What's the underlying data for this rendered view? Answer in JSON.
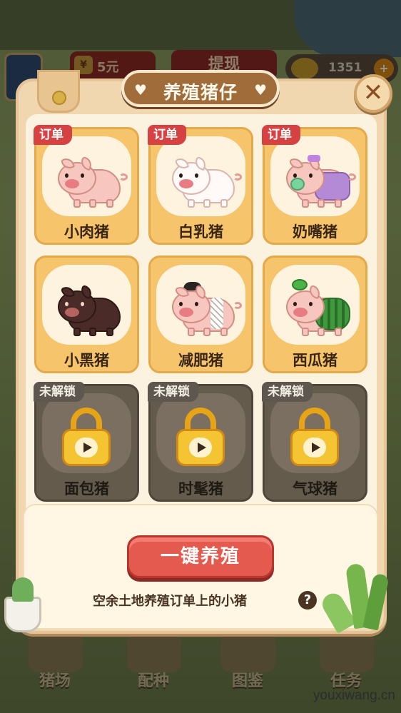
{
  "hud": {
    "cash_icon": "¥",
    "cash_value": "5元",
    "withdraw_label": "提现",
    "coins_value": "1351",
    "coins_add": "+"
  },
  "dialog": {
    "title": "养殖猪仔",
    "heart_glyph": "♥",
    "close_glyph": "✕",
    "cards": [
      {
        "name": "小肉猪",
        "tag": "订单",
        "locked": false
      },
      {
        "name": "白乳猪",
        "tag": "订单",
        "locked": false
      },
      {
        "name": "奶嘴猪",
        "tag": "订单",
        "locked": false
      },
      {
        "name": "小黑猪",
        "tag": "",
        "locked": false
      },
      {
        "name": "减肥猪",
        "tag": "",
        "locked": false
      },
      {
        "name": "西瓜猪",
        "tag": "",
        "locked": false
      },
      {
        "name": "面包猪",
        "tag": "未解锁",
        "locked": true
      },
      {
        "name": "时髦猪",
        "tag": "未解锁",
        "locked": true
      },
      {
        "name": "气球猪",
        "tag": "未解锁",
        "locked": true
      }
    ],
    "action_button": "一键养殖",
    "hint": "空余土地养殖订单上的小猪",
    "help_glyph": "?"
  },
  "bottom_nav": [
    {
      "label": "猪场"
    },
    {
      "label": "配种"
    },
    {
      "label": "图鉴"
    },
    {
      "label": "任务"
    }
  ],
  "watermark": "youxiwang.cn",
  "colors": {
    "tag_order": "#d64242",
    "tag_locked": "#5d574f",
    "action_button": "#e45a4e",
    "card_bg": "#f5c46b"
  }
}
